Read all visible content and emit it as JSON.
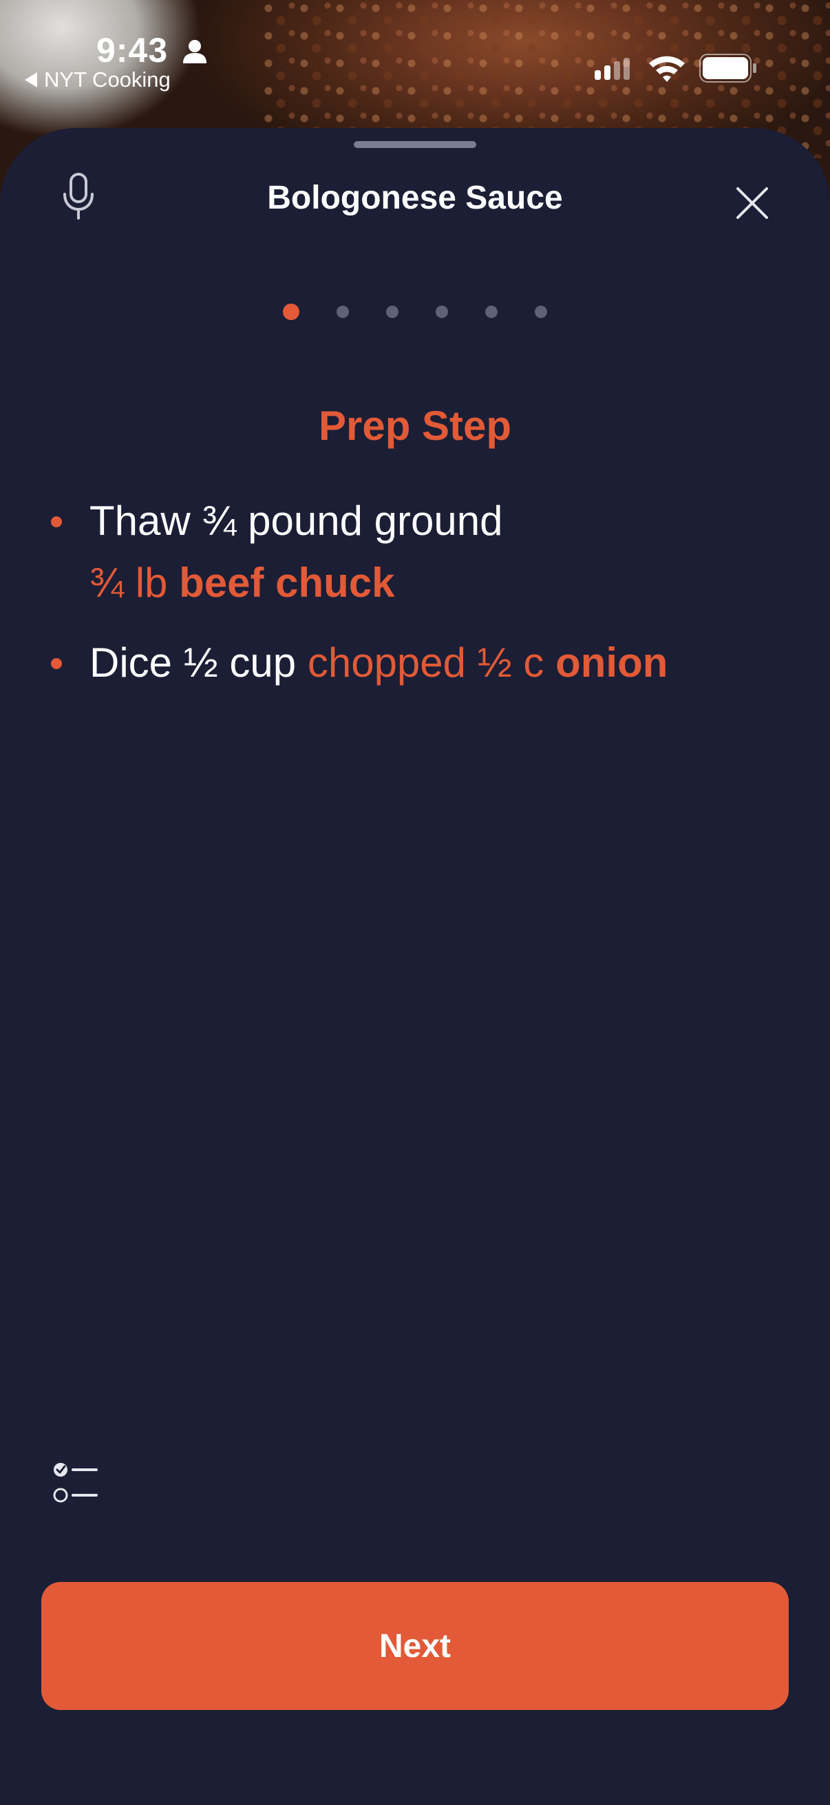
{
  "status_bar": {
    "time": "9:43",
    "back_app_label": "NYT Cooking",
    "icons": [
      "person-icon",
      "signal-icon",
      "wifi-icon",
      "battery-icon"
    ]
  },
  "header": {
    "title": "Bologonese Sauce",
    "mic_icon": "microphone-icon",
    "close_icon": "close-icon"
  },
  "pagination": {
    "total": 6,
    "current": 1
  },
  "step": {
    "title": "Prep Step",
    "items": [
      {
        "text_before": "Thaw ¾ pound ground",
        "ingredient_amount": "¾ lb",
        "ingredient_name": "beef chuck"
      },
      {
        "text_before": "Dice ½ cup",
        "ingredient_amount": "chopped ½ c",
        "ingredient_name": "onion"
      }
    ]
  },
  "footer": {
    "checklist_icon": "checklist-icon",
    "next_label": "Next"
  },
  "colors": {
    "accent": "#e25a37",
    "sheet_background": "#1b1e35",
    "inactive_dot": "#5e6178"
  }
}
